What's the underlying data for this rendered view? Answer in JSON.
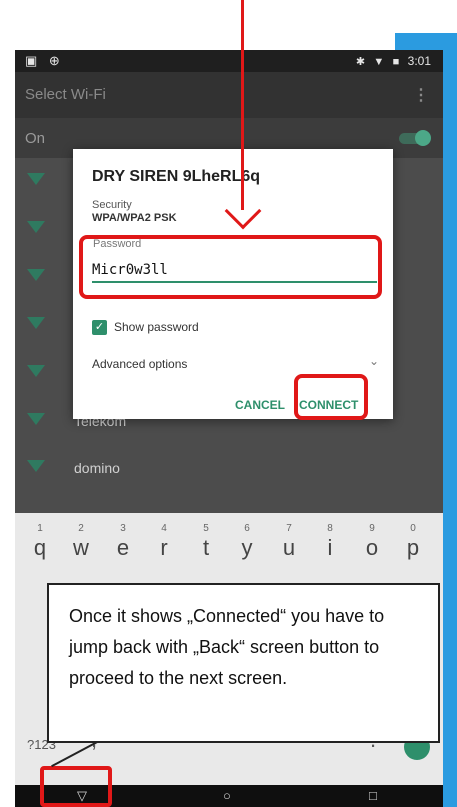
{
  "status_bar": {
    "left_icons": "▣ ⊕",
    "bluetooth_icon": "✱",
    "wifi_icon": "▼",
    "battery_icon": "■",
    "time": "3:01"
  },
  "app_bar": {
    "title": "Select Wi-Fi",
    "more_icon": "⋮"
  },
  "wifi_switch": {
    "label": "On",
    "state": "on"
  },
  "networks": [
    {
      "name": ""
    },
    {
      "name": ""
    },
    {
      "name": ""
    },
    {
      "name": ""
    },
    {
      "name": ""
    },
    {
      "name": "Telekom"
    },
    {
      "name": "domino"
    }
  ],
  "dialog": {
    "title": "DRY SIREN 9LheRL6q",
    "security_label": "Security",
    "security_value": "WPA/WPA2 PSK",
    "password_label": "Password",
    "password_value": "Micr0w3ll",
    "show_password_label": "Show password",
    "show_password_checked": true,
    "advanced_options_label": "Advanced options",
    "chevron": "⌄",
    "cancel_label": "CANCEL",
    "connect_label": "CONNECT"
  },
  "keyboard": {
    "row1": [
      {
        "key": "q",
        "num": "1"
      },
      {
        "key": "w",
        "num": "2"
      },
      {
        "key": "e",
        "num": "3"
      },
      {
        "key": "r",
        "num": "4"
      },
      {
        "key": "t",
        "num": "5"
      },
      {
        "key": "y",
        "num": "6"
      },
      {
        "key": "u",
        "num": "7"
      },
      {
        "key": "i",
        "num": "8"
      },
      {
        "key": "o",
        "num": "9"
      },
      {
        "key": "p",
        "num": "0"
      }
    ],
    "symbols_label": "?123",
    "comma": ",",
    "period": "."
  },
  "nav_bar": {
    "back": "▽",
    "home": "○",
    "recents": "□"
  },
  "annotation": {
    "callout_text": "Once it shows „Connected“ you have to jump back with „Back“ screen button to proceed to the next screen.",
    "highlight_color": "#e01818"
  },
  "colors": {
    "accent": "#2e8f6b",
    "side_strip": "#2b9be0"
  }
}
